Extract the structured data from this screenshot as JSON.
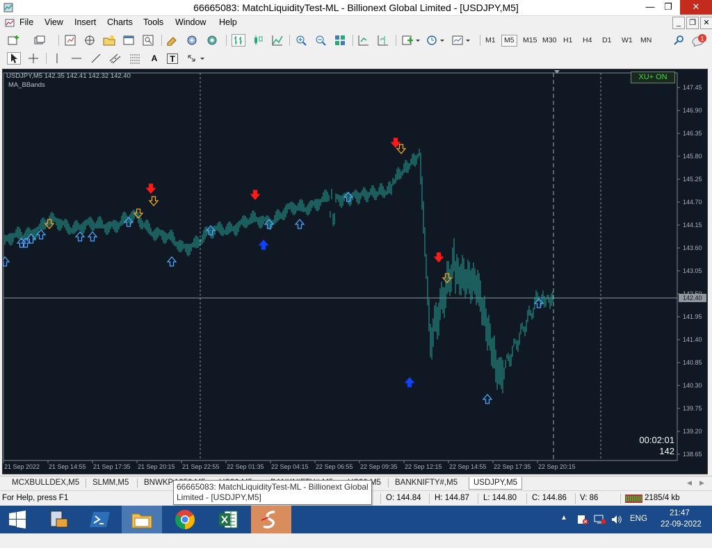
{
  "window": {
    "title": "66665083: MatchLiquidityTest-ML - Billionext Global Limited - [USDJPY,M5]",
    "minimize": "—",
    "restore": "❐",
    "close": "✕"
  },
  "menu": {
    "items": [
      "File",
      "View",
      "Insert",
      "Charts",
      "Tools",
      "Window",
      "Help"
    ]
  },
  "mdi_controls": {
    "minimize": "_",
    "restore": "❐",
    "close": "✕"
  },
  "toolbar": {
    "timeframes": [
      "M1",
      "M5",
      "M15",
      "M30",
      "H1",
      "H4",
      "D1",
      "W1",
      "MN"
    ],
    "active_timeframe": "M5",
    "notification_count": "1"
  },
  "drawing_toolbar": {
    "text_tool": "A",
    "label_tool": "T"
  },
  "chart": {
    "symbol_line": "USDJPY,M5  142.35 142.41 142.32 142.40",
    "indicator": "MA_BBands",
    "xu_button": "XU+ ON",
    "countdown": "00:02:01",
    "tick_volume": "142",
    "current_price_label": "142.40",
    "background": "#0f1823",
    "bar_color": "#2aa39a"
  },
  "chart_data": {
    "type": "line",
    "title": "USDJPY,M5",
    "y_ticks": [
      "147.45",
      "146.90",
      "146.35",
      "145.80",
      "145.25",
      "144.70",
      "144.15",
      "143.60",
      "143.05",
      "142.50",
      "141.95",
      "141.40",
      "140.85",
      "140.30",
      "139.75",
      "139.20",
      "138.65"
    ],
    "x_ticks": [
      "21 Sep 2022",
      "21 Sep 14:55",
      "21 Sep 17:35",
      "21 Sep 20:15",
      "21 Sep 22:55",
      "22 Sep 01:35",
      "22 Sep 04:15",
      "22 Sep 06:55",
      "22 Sep 09:35",
      "22 Sep 12:15",
      "22 Sep 14:55",
      "22 Sep 17:35",
      "22 Sep 20:15"
    ],
    "ylim": [
      138.5,
      147.8
    ],
    "current_price": 142.4,
    "series": [
      {
        "x": [
          "21 Sep 2022",
          "21 Sep 14:55",
          "21 Sep 17:35",
          "21 Sep 20:15",
          "21 Sep 22:55",
          "22 Sep 01:35",
          "22 Sep 04:15",
          "22 Sep 06:55",
          "22 Sep 09:35",
          "22 Sep 12:15",
          "22 Sep 14:55",
          "22 Sep 17:35",
          "22 Sep 20:15"
        ],
        "values": [
          143.7,
          144.2,
          144.1,
          144.3,
          143.6,
          144.1,
          144.3,
          144.7,
          144.9,
          144.0,
          142.6,
          140.4,
          142.4
        ]
      }
    ],
    "signals": [
      {
        "type": "sell",
        "color": "red",
        "time": "21 Sep 21:05",
        "price": 145.0
      },
      {
        "type": "sell",
        "color": "red",
        "time": "22 Sep 03:20",
        "price": 144.85
      },
      {
        "type": "sell",
        "color": "red",
        "time": "22 Sep 11:45",
        "price": 146.1
      },
      {
        "type": "sell",
        "color": "red",
        "time": "22 Sep 14:20",
        "price": 143.35
      },
      {
        "type": "sell",
        "color": "orange",
        "time": "21 Sep 15:00",
        "price": 144.15
      },
      {
        "type": "sell",
        "color": "orange",
        "time": "21 Sep 20:20",
        "price": 144.4
      },
      {
        "type": "sell",
        "color": "orange",
        "time": "21 Sep 21:15",
        "price": 144.7
      },
      {
        "type": "sell",
        "color": "orange",
        "time": "22 Sep 12:05",
        "price": 145.95
      },
      {
        "type": "sell",
        "color": "orange",
        "time": "22 Sep 14:50",
        "price": 142.85
      },
      {
        "type": "buy",
        "color": "lightblue",
        "time": "21 Sep 12:20",
        "price": 143.3
      },
      {
        "type": "buy",
        "color": "lightblue",
        "time": "21 Sep 13:20",
        "price": 143.75
      },
      {
        "type": "buy",
        "color": "lightblue",
        "time": "21 Sep 13:35",
        "price": 143.75
      },
      {
        "type": "buy",
        "color": "lightblue",
        "time": "21 Sep 13:55",
        "price": 143.85
      },
      {
        "type": "buy",
        "color": "lightblue",
        "time": "21 Sep 14:30",
        "price": 143.95
      },
      {
        "type": "buy",
        "color": "lightblue",
        "time": "21 Sep 16:50",
        "price": 143.9
      },
      {
        "type": "buy",
        "color": "lightblue",
        "time": "21 Sep 17:35",
        "price": 143.9
      },
      {
        "type": "buy",
        "color": "lightblue",
        "time": "21 Sep 19:45",
        "price": 144.25
      },
      {
        "type": "buy",
        "color": "lightblue",
        "time": "21 Sep 22:20",
        "price": 143.3
      },
      {
        "type": "buy",
        "color": "lightblue",
        "time": "22 Sep 00:40",
        "price": 144.05
      },
      {
        "type": "buy",
        "color": "lightblue",
        "time": "22 Sep 04:10",
        "price": 144.2
      },
      {
        "type": "buy",
        "color": "lightblue",
        "time": "22 Sep 06:00",
        "price": 144.2
      },
      {
        "type": "buy",
        "color": "lightblue",
        "time": "22 Sep 08:55",
        "price": 144.85
      },
      {
        "type": "buy",
        "color": "lightblue",
        "time": "22 Sep 17:15",
        "price": 140.0
      },
      {
        "type": "buy",
        "color": "lightblue",
        "time": "22 Sep 20:20",
        "price": 142.3
      },
      {
        "type": "buy",
        "color": "blue",
        "time": "22 Sep 03:50",
        "price": 143.7
      },
      {
        "type": "buy",
        "color": "blue",
        "time": "22 Sep 12:35",
        "price": 140.4
      }
    ]
  },
  "tabs": [
    {
      "label": "MCXBULLDEX,M5",
      "active": false
    },
    {
      "label": "SLMM,M5",
      "active": false
    },
    {
      "label": "BNWKP.1050 M5",
      "active": false
    },
    {
      "label": "US30,M5",
      "active": false
    },
    {
      "label": "BANKNIFTY#,M5",
      "active": false
    },
    {
      "label": "US30,M5",
      "active": false
    },
    {
      "label": "BANKNIFTY#,M5",
      "active": false
    },
    {
      "label": "USDJPY,M5",
      "active": true
    }
  ],
  "tooltip": {
    "line1": "66665083: MatchLiquidityTest-ML - Billionext Global",
    "line2": "Limited - [USDJPY,M5]"
  },
  "status": {
    "help": "For Help, press F1",
    "open": "O: 144.84",
    "high": "H: 144.87",
    "low": "L: 144.80",
    "close": "C: 144.86",
    "volume": "V: 86",
    "traffic": "2185/4 kb"
  },
  "taskbar": {
    "language": "ENG",
    "time": "21:47",
    "date": "22-09-2022"
  }
}
